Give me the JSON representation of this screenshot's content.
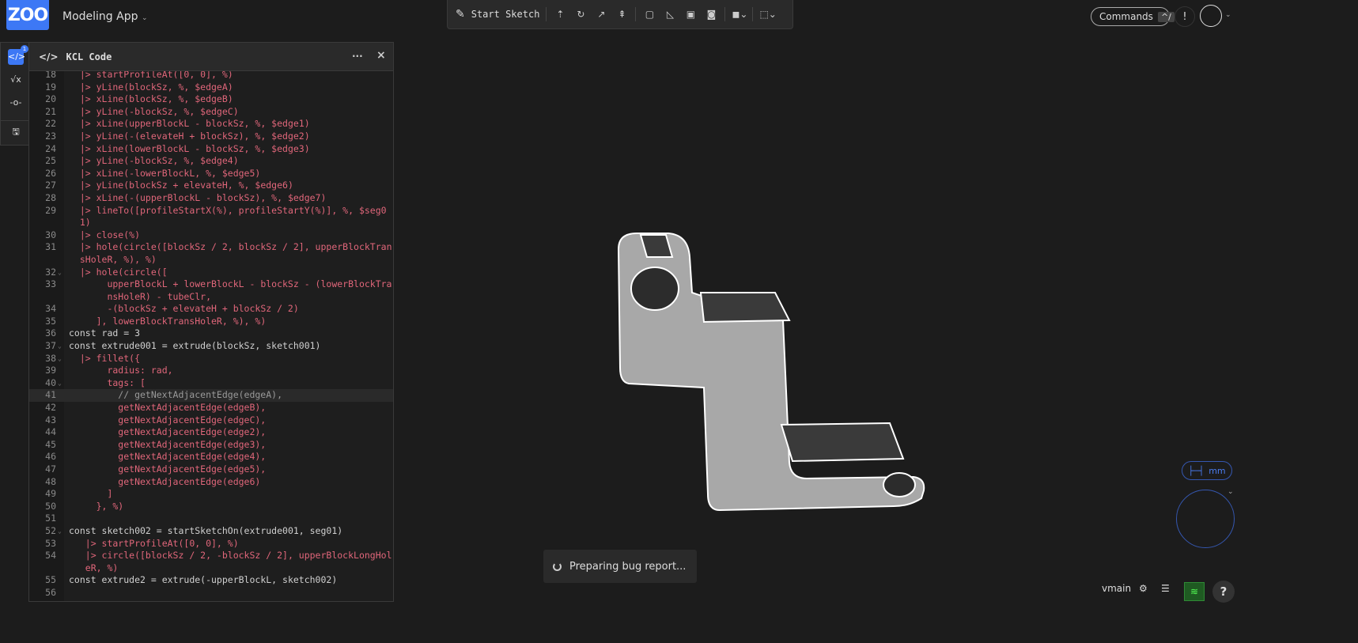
{
  "header": {
    "logo": "ZOO",
    "app_name": "Modeling App",
    "brand_color": "#3d78f5"
  },
  "toolbar": {
    "start_sketch": "Start Sketch",
    "icons": [
      "extrude-icon",
      "revolve-icon",
      "sweep-icon",
      "loft-icon",
      "fillet-icon",
      "chamfer-icon",
      "offset-plane-icon",
      "helix-icon",
      "boolean-icon",
      "selection-icon"
    ]
  },
  "topright": {
    "commands": "Commands",
    "shortcut": "^/",
    "alert": "!"
  },
  "rail": {
    "badge": "1"
  },
  "panel": {
    "title": "KCL Code",
    "menu": "···",
    "close": "×"
  },
  "code": {
    "active_line": 41,
    "lines": [
      {
        "n": 18,
        "t": "  |> startProfileAt([0, 0], %)"
      },
      {
        "n": 19,
        "t": "  |> yLine(blockSz, %, $edgeA)"
      },
      {
        "n": 20,
        "t": "  |> xLine(blockSz, %, $edgeB)"
      },
      {
        "n": 21,
        "t": "  |> yLine(-blockSz, %, $edgeC)"
      },
      {
        "n": 22,
        "t": "  |> xLine(upperBlockL - blockSz, %, $edge1)"
      },
      {
        "n": 23,
        "t": "  |> yLine(-(elevateH + blockSz), %, $edge2)"
      },
      {
        "n": 24,
        "t": "  |> xLine(lowerBlockL - blockSz, %, $edge3)"
      },
      {
        "n": 25,
        "t": "  |> yLine(-blockSz, %, $edge4)"
      },
      {
        "n": 26,
        "t": "  |> xLine(-lowerBlockL, %, $edge5)"
      },
      {
        "n": 27,
        "t": "  |> yLine(blockSz + elevateH, %, $edge6)"
      },
      {
        "n": 28,
        "t": "  |> xLine(-(upperBlockL - blockSz), %, $edge7)"
      },
      {
        "n": 29,
        "t": "  |> lineTo([profileStartX(%), profileStartY(%)], %, $seg01)"
      },
      {
        "n": 30,
        "t": "  |> close(%)"
      },
      {
        "n": 31,
        "t": "  |> hole(circle([blockSz / 2, blockSz / 2], upperBlockTransHoleR, %), %)"
      },
      {
        "n": 32,
        "t": "  |> hole(circle([",
        "fold": true
      },
      {
        "n": 33,
        "t": "       upperBlockL + lowerBlockL - blockSz - (lowerBlockTransHoleR) - tubeClr,"
      },
      {
        "n": 34,
        "t": "       -(blockSz + elevateH + blockSz / 2)"
      },
      {
        "n": 35,
        "t": "     ], lowerBlockTransHoleR, %), %)"
      },
      {
        "n": 36,
        "t": "const rad = 3"
      },
      {
        "n": 37,
        "t": "const extrude001 = extrude(blockSz, sketch001)",
        "fold": true
      },
      {
        "n": 38,
        "t": "  |> fillet({",
        "fold": true
      },
      {
        "n": 39,
        "t": "       radius: rad,"
      },
      {
        "n": 40,
        "t": "       tags: [",
        "fold": true
      },
      {
        "n": 41,
        "t": "         // getNextAdjacentEdge(edgeA),"
      },
      {
        "n": 42,
        "t": "         getNextAdjacentEdge(edgeB),"
      },
      {
        "n": 43,
        "t": "         getNextAdjacentEdge(edgeC),"
      },
      {
        "n": 44,
        "t": "         getNextAdjacentEdge(edge2),"
      },
      {
        "n": 45,
        "t": "         getNextAdjacentEdge(edge3),"
      },
      {
        "n": 46,
        "t": "         getNextAdjacentEdge(edge4),"
      },
      {
        "n": 47,
        "t": "         getNextAdjacentEdge(edge5),"
      },
      {
        "n": 48,
        "t": "         getNextAdjacentEdge(edge6)"
      },
      {
        "n": 49,
        "t": "       ]"
      },
      {
        "n": 50,
        "t": "     }, %)"
      },
      {
        "n": 51,
        "t": ""
      },
      {
        "n": 52,
        "t": "const sketch002 = startSketchOn(extrude001, seg01)",
        "fold": true
      },
      {
        "n": 53,
        "t": "   |> startProfileAt([0, 0], %)"
      },
      {
        "n": 54,
        "t": "   |> circle([blockSz / 2, -blockSz / 2], upperBlockLongHoleR, %)"
      },
      {
        "n": 55,
        "t": "const extrude2 = extrude(-upperBlockL, sketch002)"
      },
      {
        "n": 56,
        "t": ""
      }
    ]
  },
  "toast": {
    "text": "Preparing bug report..."
  },
  "viewport": {
    "units": "mm"
  },
  "statusbar": {
    "version": "vmain",
    "network_color": "#2f8a35",
    "help": "?"
  }
}
